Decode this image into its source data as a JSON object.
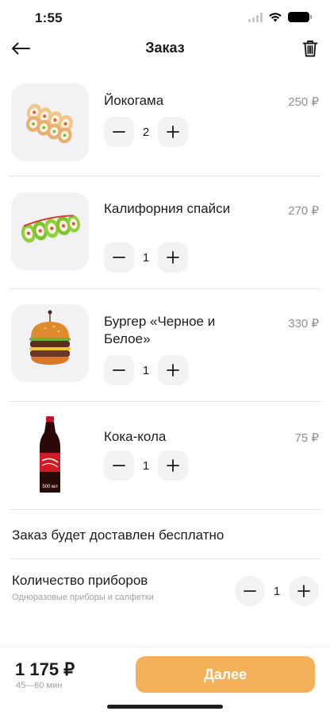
{
  "status": {
    "time": "1:55"
  },
  "header": {
    "title": "Заказ"
  },
  "items": [
    {
      "name": "Йокогама",
      "price": "250 ₽",
      "qty": "2"
    },
    {
      "name": "Калифорния спайси",
      "price": "270 ₽",
      "qty": "1"
    },
    {
      "name": "Бургер «Черное и Белое»",
      "price": "330 ₽",
      "qty": "1"
    },
    {
      "name": "Кока-кола",
      "price": "75 ₽",
      "qty": "1"
    }
  ],
  "delivery": {
    "text": "Заказ будет доставлен бесплатно"
  },
  "cutlery": {
    "title": "Количество приборов",
    "subtitle": "Одноразовые приборы и салфетки",
    "qty": "1"
  },
  "footer": {
    "total": "1 175 ₽",
    "eta": "45—60 мин",
    "next_label": "Далее"
  },
  "bottle_label": "500 мл",
  "colors": {
    "accent": "#f4b15a",
    "muted": "#8e8e93",
    "chip_bg": "#f2f2f4"
  },
  "icons": [
    "back-arrow-icon",
    "trash-icon",
    "minus-icon",
    "plus-icon",
    "wifi-icon",
    "battery-icon"
  ]
}
